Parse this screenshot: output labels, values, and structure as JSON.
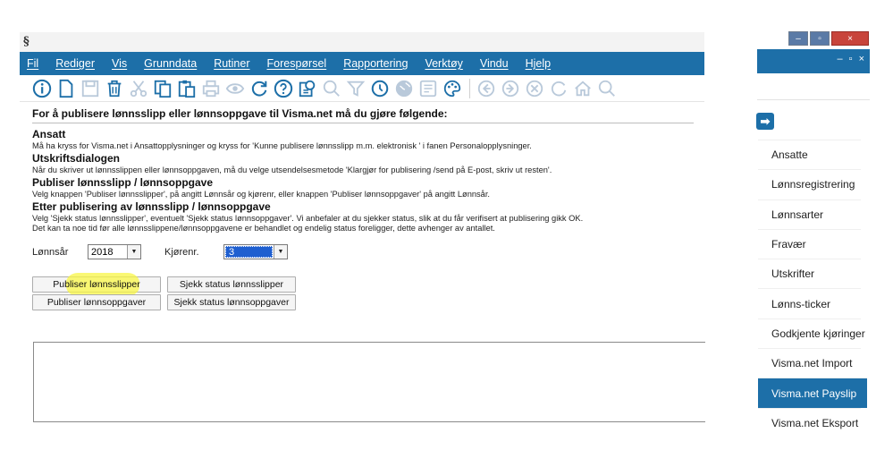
{
  "menu": [
    {
      "label": "Fil",
      "underline": true
    },
    {
      "label": "Rediger",
      "underline": true
    },
    {
      "label": "Vis",
      "underline": true
    },
    {
      "label": "Grunndata",
      "underline": true
    },
    {
      "label": "Rutiner",
      "underline": true
    },
    {
      "label": "Forespørsel",
      "underline": true
    },
    {
      "label": "Rapportering",
      "underline": true
    },
    {
      "label": "Verktøy",
      "underline": true
    },
    {
      "label": "Vindu",
      "underline": true
    },
    {
      "label": "Hjelp",
      "underline": true
    }
  ],
  "toolbar_icons": [
    "info-icon",
    "new-document-icon",
    "save-icon",
    "delete-icon",
    "cut-icon",
    "copy-icon",
    "paste-icon",
    "print-icon",
    "preview-icon",
    "refresh-icon",
    "help-icon",
    "settings-search-icon",
    "search-icon",
    "filter-icon",
    "history-icon",
    "globe-icon",
    "notes-icon",
    "palette-icon",
    "back-icon",
    "forward-icon",
    "stop-icon",
    "reload-icon",
    "home-icon",
    "zoom-icon"
  ],
  "main": {
    "heading": "For å publisere lønnsslipp eller lønnsoppgave til Visma.net må du gjøre følgende:",
    "sections": [
      {
        "title": "Ansatt",
        "lines": [
          "Må ha kryss for Visma.net i Ansattopplysninger og kryss for 'Kunne publisere lønnsslipp m.m. elektronisk ' i fanen Personalopplysninger."
        ]
      },
      {
        "title": "Utskriftsdialogen",
        "lines": [
          "Når du skriver ut lønnsslippen eller lønnsoppgaven, må du velge utsendelsesmetode 'Klargjør for publisering /send på E-post, skriv ut resten'."
        ]
      },
      {
        "title": "Publiser lønnsslipp / lønnsoppgave",
        "lines": [
          "Velg knappen 'Publiser lønnsslipper', på angitt Lønnsår og kjørenr, eller knappen 'Publiser lønnsoppgaver' på angitt Lønnsår."
        ]
      },
      {
        "title": "Etter publisering av lønnsslipp / lønnsoppgave",
        "lines": [
          "Velg 'Sjekk status lønnsslipper', eventuelt 'Sjekk status lønnsoppgaver'. Vi anbefaler at du sjekker status, slik at du får verifisert at publisering gikk OK.",
          "Det kan ta noe tid før alle lønnsslippene/lønnsoppgavene er behandlet og endelig status foreligger, dette avhenger av antallet."
        ]
      }
    ],
    "form": {
      "year_label": "Lønnsår",
      "year_value": "2018",
      "run_label": "Kjørenr.",
      "run_value": "3"
    },
    "buttons": {
      "publish_payslips": "Publiser lønnsslipper",
      "check_payslips": "Sjekk status lønnsslipper",
      "publish_statements": "Publiser lønnsoppgaver",
      "check_statements": "Sjekk status lønnsoppgaver"
    }
  },
  "window_controls": {
    "minimize": "–",
    "restore": "▫",
    "close": "×"
  },
  "side_header_controls": "– ▫ ×",
  "side_arrow": "➡",
  "side_nav": [
    {
      "label": "Ansatte",
      "active": false
    },
    {
      "label": "Lønnsregistrering",
      "active": false
    },
    {
      "label": "Lønnsarter",
      "active": false
    },
    {
      "label": "Fravær",
      "active": false
    },
    {
      "label": "Utskrifter",
      "active": false
    },
    {
      "label": "Lønns-ticker",
      "active": false
    },
    {
      "label": "Godkjente kjøringer",
      "active": false
    },
    {
      "label": "Visma.net Import",
      "active": false
    },
    {
      "label": "Visma.net Payslip",
      "active": true
    },
    {
      "label": "Visma.net Eksport",
      "active": false
    }
  ],
  "colors": {
    "brand_blue": "#1d6fa8",
    "highlight_yellow": "#f8f546",
    "close_red": "#c8443b"
  }
}
